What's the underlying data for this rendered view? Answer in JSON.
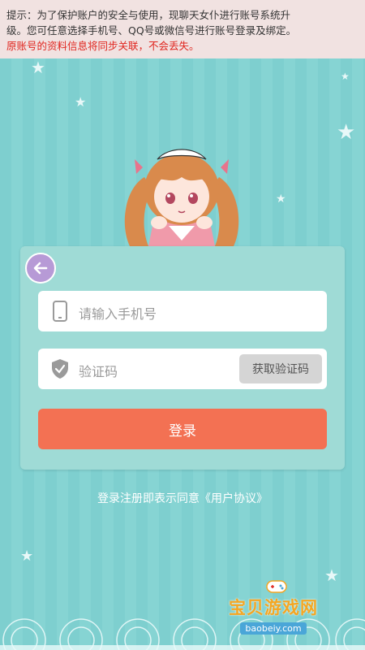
{
  "notice": {
    "line1": "提示：为了保护账户的安全与使用，现聊天女仆进行账号系统升",
    "line2": "级。您可任意选择手机号、QQ号或微信号进行账号登录及绑定。",
    "line3": "原账号的资料信息将同步关联，不会丢失。"
  },
  "form": {
    "phone_placeholder": "请输入手机号",
    "code_placeholder": "验证码",
    "get_code_label": "获取验证码",
    "login_label": "登录"
  },
  "agreement": {
    "prefix": "登录注册即表示同意",
    "link": "《用户协议》"
  },
  "watermark": {
    "name": "宝贝游戏网",
    "domain": "baobeiy.com"
  },
  "icons": {
    "back": "back-arrow-icon",
    "phone": "phone-icon",
    "shield": "shield-check-icon"
  },
  "colors": {
    "background": "#7ecfcf",
    "card": "#9fdbd6",
    "login_button": "#f37153",
    "back_button": "#b79ad6",
    "notice_red": "#e0261f"
  }
}
